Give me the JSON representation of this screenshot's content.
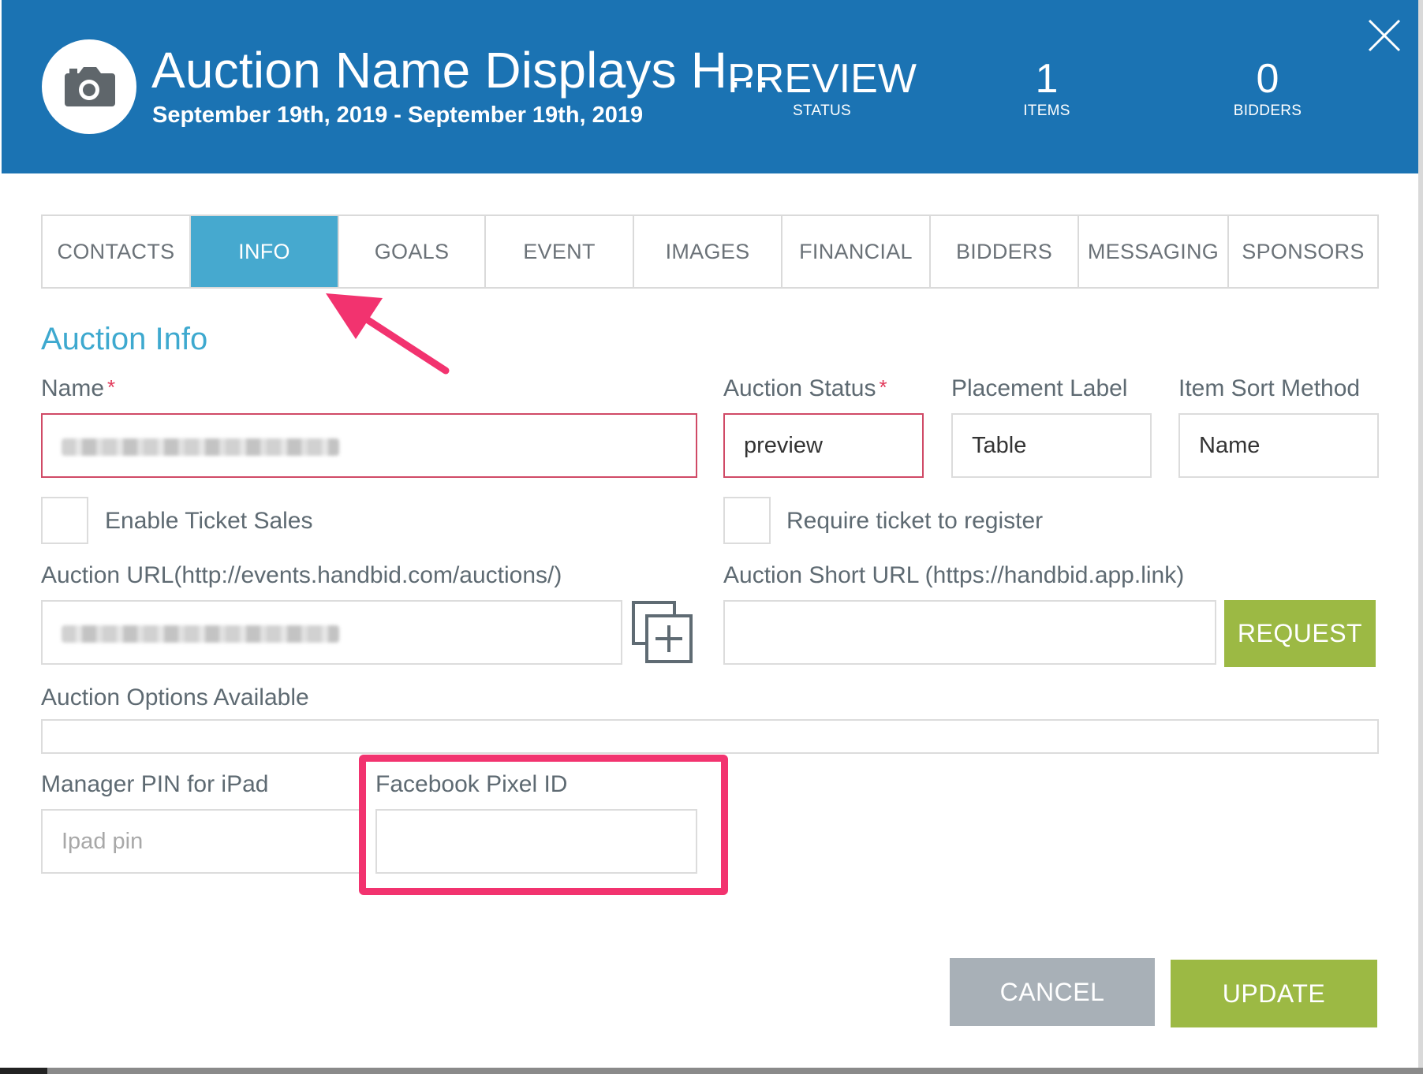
{
  "header": {
    "auction_name": "Auction Name Displays H...",
    "date_range": "September 19th, 2019 - September 19th, 2019",
    "status_value": "PREVIEW",
    "status_label": "STATUS",
    "items_value": "1",
    "items_label": "ITEMS",
    "bidders_value": "0",
    "bidders_label": "BIDDERS",
    "icons": {
      "avatar": "camera-icon",
      "close": "close-icon"
    },
    "background_color": "#1b73b3"
  },
  "tabs": [
    {
      "label": "CONTACTS",
      "active": false
    },
    {
      "label": "INFO",
      "active": true
    },
    {
      "label": "GOALS",
      "active": false
    },
    {
      "label": "EVENT",
      "active": false
    },
    {
      "label": "IMAGES",
      "active": false
    },
    {
      "label": "FINANCIAL",
      "active": false
    },
    {
      "label": "BIDDERS",
      "active": false
    },
    {
      "label": "MESSAGING",
      "active": false
    },
    {
      "label": "SPONSORS",
      "active": false
    }
  ],
  "section_title": "Auction Info",
  "form": {
    "name_label": "Name",
    "required_mark": "*",
    "auction_status_label": "Auction Status",
    "auction_status_value": "preview",
    "placement_label_label": "Placement Label",
    "placement_label_value": "Table",
    "item_sort_label": "Item Sort Method",
    "item_sort_value": "Name",
    "enable_ticket_sales_label": "Enable Ticket Sales",
    "require_ticket_label": "Require ticket to register",
    "auction_url_label": "Auction URL(http://events.handbid.com/auctions/)",
    "auction_short_url_label": "Auction Short URL (https://handbid.app.link)",
    "request_button": "REQUEST",
    "auction_options_label": "Auction Options Available",
    "manager_pin_label": "Manager PIN for iPad",
    "manager_pin_placeholder": "Ipad pin",
    "facebook_pixel_label": "Facebook Pixel ID",
    "icons": {
      "copy": "copy-add-icon"
    }
  },
  "actions": {
    "cancel": "CANCEL",
    "update": "UPDATE"
  },
  "colors": {
    "accent": "#46a9cf",
    "primary_button": "#9cb944",
    "secondary_button": "#a8b0b7",
    "annotation": "#f2336f",
    "error_border": "#d04a66"
  }
}
